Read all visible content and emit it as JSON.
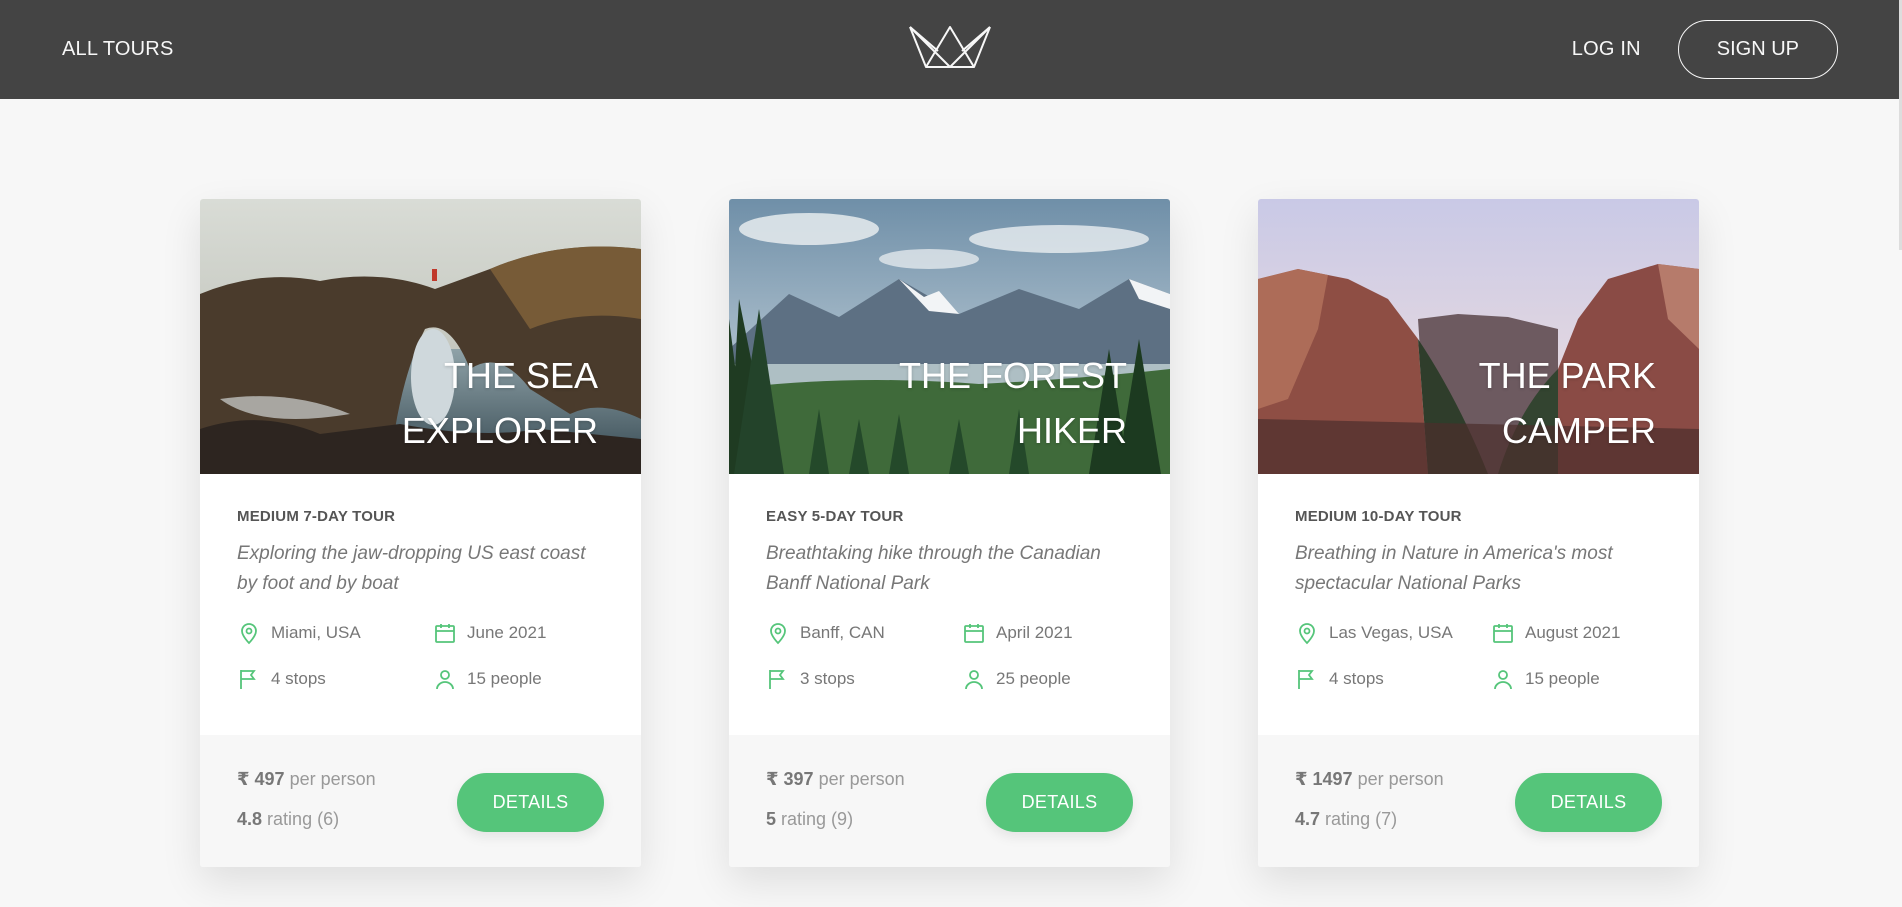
{
  "header": {
    "all_tours": "ALL TOURS",
    "login": "LOG IN",
    "signup": "SIGN UP"
  },
  "tours": [
    {
      "title": "THE SEA EXPLORER",
      "subheading": "MEDIUM 7-DAY TOUR",
      "summary": "Exploring the jaw-dropping US east coast by foot and by boat",
      "location": "Miami, USA",
      "date": "June 2021",
      "stops": "4 stops",
      "people": "15 people",
      "price": "₹ 497",
      "price_suffix": "per person",
      "rating": "4.8",
      "rating_suffix": "rating (6)",
      "button": "DETAILS"
    },
    {
      "title": "THE FOREST HIKER",
      "subheading": "EASY 5-DAY TOUR",
      "summary": "Breathtaking hike through the Canadian Banff National Park",
      "location": "Banff, CAN",
      "date": "April 2021",
      "stops": "3 stops",
      "people": "25 people",
      "price": "₹ 397",
      "price_suffix": "per person",
      "rating": "5",
      "rating_suffix": "rating (9)",
      "button": "DETAILS"
    },
    {
      "title": "THE PARK CAMPER",
      "subheading": "MEDIUM 10-DAY TOUR",
      "summary": "Breathing in Nature in America's most spectacular National Parks",
      "location": "Las Vegas, USA",
      "date": "August 2021",
      "stops": "4 stops",
      "people": "15 people",
      "price": "₹ 1497",
      "price_suffix": "per person",
      "rating": "4.7",
      "rating_suffix": "rating (7)",
      "button": "DETAILS"
    }
  ],
  "colors": {
    "header_bg": "#444444",
    "accent": "#55c57a",
    "page_bg": "#f7f7f7"
  }
}
